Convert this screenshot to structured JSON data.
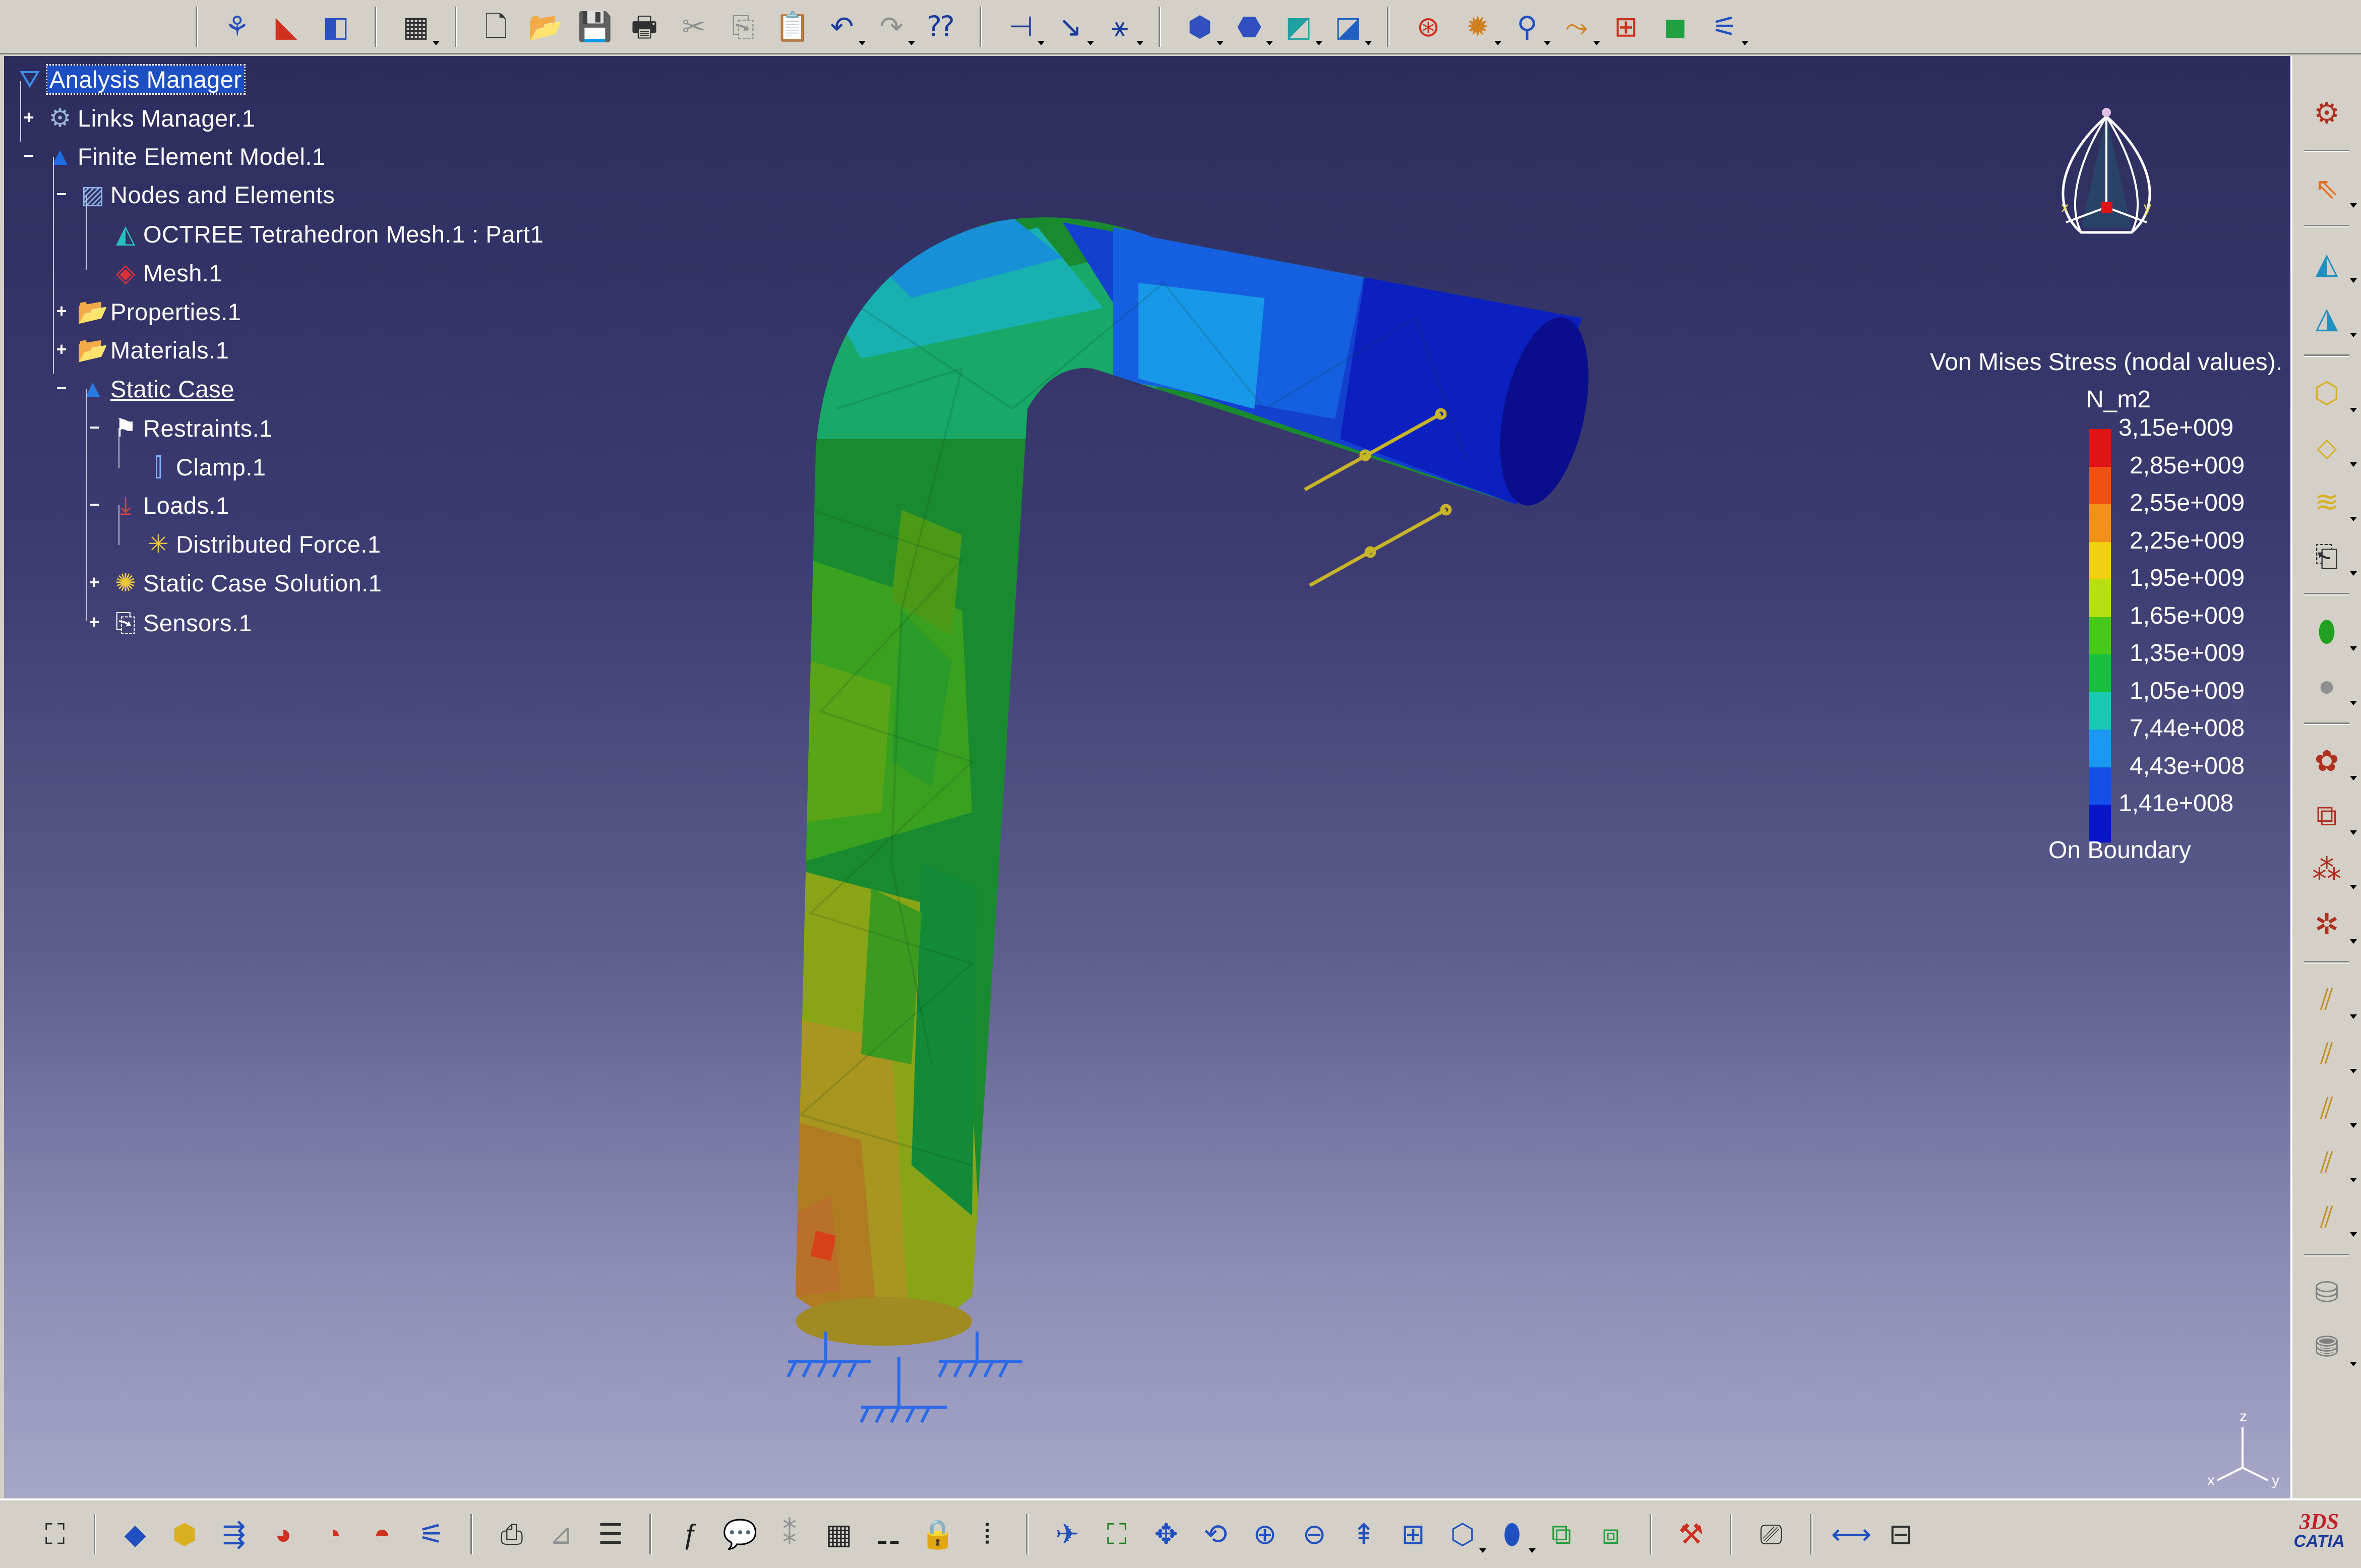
{
  "tree": {
    "nodes": [
      {
        "label": "Analysis Manager",
        "icon": "analysis-manager-icon",
        "glyph": "⛛",
        "color": "#3b8ee8"
      },
      {
        "label": "Links Manager.1",
        "icon": "links-manager-icon",
        "glyph": "⚙",
        "color": "#9ab3d9"
      },
      {
        "label": "Finite Element Model.1",
        "icon": "finite-element-model-icon",
        "glyph": "▲",
        "color": "#1f6ce0"
      },
      {
        "label": "Nodes and Elements",
        "icon": "nodes-elements-icon",
        "glyph": "▨",
        "color": "#8fb4e8"
      },
      {
        "label": "OCTREE Tetrahedron Mesh.1 : Part1",
        "icon": "tetra-mesh-icon",
        "glyph": "◭",
        "color": "#27c0c0"
      },
      {
        "label": "Mesh.1",
        "icon": "mesh-icon",
        "glyph": "◈",
        "color": "#d8303a"
      },
      {
        "label": "Properties.1",
        "icon": "folder-icon",
        "glyph": "📂",
        "color": "#e8c440"
      },
      {
        "label": "Materials.1",
        "icon": "folder-icon",
        "glyph": "📂",
        "color": "#e8c440"
      },
      {
        "label": "Static Case",
        "icon": "static-case-icon",
        "glyph": "▲",
        "color": "#2a7ae2"
      },
      {
        "label": "Restraints.1",
        "icon": "restraints-icon",
        "glyph": "⚑",
        "color": "#ffffff"
      },
      {
        "label": "Clamp.1",
        "icon": "clamp-icon",
        "glyph": "⫿",
        "color": "#80b0ff"
      },
      {
        "label": "Loads.1",
        "icon": "loads-icon",
        "glyph": "⤓",
        "color": "#e04040"
      },
      {
        "label": "Distributed Force.1",
        "icon": "distributed-force-icon",
        "glyph": "✳",
        "color": "#e8c440"
      },
      {
        "label": "Static Case Solution.1",
        "icon": "solution-icon",
        "glyph": "✺",
        "color": "#e8c440"
      },
      {
        "label": "Sensors.1",
        "icon": "sensors-icon",
        "glyph": "⎘",
        "color": "#ffffff"
      }
    ]
  },
  "legend": {
    "title": "Von Mises Stress (nodal values).",
    "unit": "N_m2",
    "values": [
      "3,15e+009",
      "2,85e+009",
      "2,55e+009",
      "2,25e+009",
      "1,95e+009",
      "1,65e+009",
      "1,35e+009",
      "1,05e+009",
      "7,44e+008",
      "4,43e+008",
      "1,41e+008"
    ],
    "colors": [
      "#e01414",
      "#f25010",
      "#f29018",
      "#f0d010",
      "#b8e010",
      "#48c818",
      "#18c040",
      "#18c8b0",
      "#1898f0",
      "#1450e8",
      "#0a14c8"
    ],
    "footer": "On Boundary"
  },
  "compass": {
    "x_label": "x",
    "y_label": "y"
  },
  "axis": {
    "x": "x",
    "y": "y",
    "z": "z"
  },
  "logo": {
    "mark": "3DS",
    "text": "CATIA"
  },
  "toolbars": {
    "top": [
      {
        "name": "sep"
      },
      {
        "name": "knowledge-icon",
        "glyph": "⚘",
        "color": "#2a4fbf"
      },
      {
        "name": "analysis-workbench-icon",
        "glyph": "◣",
        "color": "#d03020"
      },
      {
        "name": "sketch-analysis-icon",
        "glyph": "◧",
        "color": "#2a4fbf"
      },
      {
        "name": "sep"
      },
      {
        "name": "calculator-icon",
        "glyph": "▦",
        "color": "#303030",
        "drop": true
      },
      {
        "name": "sep"
      },
      {
        "name": "new-document-icon",
        "glyph": "🗋",
        "color": "#303030"
      },
      {
        "name": "open-folder-icon",
        "glyph": "📂",
        "color": "#d8a820"
      },
      {
        "name": "save-icon",
        "glyph": "💾",
        "color": "#303030"
      },
      {
        "name": "print-icon",
        "glyph": "🖶",
        "color": "#303030"
      },
      {
        "name": "cut-icon",
        "glyph": "✂",
        "color": "#909090"
      },
      {
        "name": "copy-icon",
        "glyph": "⎘",
        "color": "#909090"
      },
      {
        "name": "paste-icon",
        "glyph": "📋",
        "color": "#909090"
      },
      {
        "name": "undo-icon",
        "glyph": "↶",
        "color": "#1a3c9c",
        "drop": true
      },
      {
        "name": "redo-icon",
        "glyph": "↷",
        "color": "#909090",
        "drop": true
      },
      {
        "name": "whats-this-icon",
        "glyph": "⁇",
        "color": "#1a3c9c"
      },
      {
        "name": "sep"
      },
      {
        "name": "restraint-icon",
        "glyph": "⊣",
        "color": "#1a3c9c",
        "drop": true
      },
      {
        "name": "load-icon",
        "glyph": "↘",
        "color": "#1a3c9c",
        "drop": true
      },
      {
        "name": "mass-icon",
        "glyph": "⚹",
        "color": "#1a3c9c",
        "drop": true
      },
      {
        "name": "sep"
      },
      {
        "name": "compute-icon",
        "glyph": "⬢",
        "color": "#3050c0",
        "drop": true
      },
      {
        "name": "mesh-view-icon",
        "glyph": "⬣",
        "color": "#3050c0",
        "drop": true
      },
      {
        "name": "deformation-icon",
        "glyph": "◩",
        "color": "#20a0a0",
        "drop": true
      },
      {
        "name": "stress-icon",
        "glyph": "◪",
        "color": "#2060c0",
        "drop": true
      },
      {
        "name": "sep"
      },
      {
        "name": "image-edit-icon",
        "glyph": "⊛",
        "color": "#d03020"
      },
      {
        "name": "animate-icon",
        "glyph": "✹",
        "color": "#d08020",
        "drop": true
      },
      {
        "name": "light-icon",
        "glyph": "⚲",
        "color": "#2050c0",
        "drop": true
      },
      {
        "name": "cut-plane-icon",
        "glyph": "⤳",
        "color": "#d08020",
        "drop": true
      },
      {
        "name": "amplification-icon",
        "glyph": "⊞",
        "color": "#d03020"
      },
      {
        "name": "palette-icon",
        "glyph": "◼",
        "color": "#20a040"
      },
      {
        "name": "report-icon",
        "glyph": "⚟",
        "color": "#2050c0",
        "drop": true
      }
    ],
    "right": [
      {
        "name": "settings-icon",
        "glyph": "⚙",
        "color": "#b03020"
      },
      {
        "name": "sep"
      },
      {
        "name": "select-icon",
        "glyph": "⇖",
        "color": "#e07020",
        "drop": true
      },
      {
        "name": "sep"
      },
      {
        "name": "mesh-part-icon",
        "glyph": "◭",
        "color": "#2090c0",
        "drop": true
      },
      {
        "name": "mesh-spec-icon",
        "glyph": "◮",
        "color": "#2090c0",
        "drop": true
      },
      {
        "name": "sep"
      },
      {
        "name": "cube-icon",
        "glyph": "⬡",
        "color": "#d8b020",
        "drop": true
      },
      {
        "name": "plate-icon",
        "glyph": "⬦",
        "color": "#d8b020",
        "drop": true
      },
      {
        "name": "layers-icon",
        "glyph": "≋",
        "color": "#d8b020",
        "drop": true
      },
      {
        "name": "user-property-icon",
        "glyph": "⎗",
        "color": "#303030",
        "drop": true
      },
      {
        "name": "sep"
      },
      {
        "name": "material-icon",
        "glyph": "⬮",
        "color": "#20a020",
        "drop": true
      },
      {
        "name": "sphere-icon",
        "glyph": "●",
        "color": "#909090",
        "drop": true
      },
      {
        "name": "sep"
      },
      {
        "name": "group-icon",
        "glyph": "✿",
        "color": "#b03020",
        "drop": true
      },
      {
        "name": "group-box-icon",
        "glyph": "⧉",
        "color": "#b03020",
        "drop": true
      },
      {
        "name": "group-point-icon",
        "glyph": "⁂",
        "color": "#b03020",
        "drop": true
      },
      {
        "name": "group-sphere-icon",
        "glyph": "✲",
        "color": "#b03020",
        "drop": true
      },
      {
        "name": "sep"
      },
      {
        "name": "connection-icon",
        "glyph": "⫽",
        "color": "#c09020",
        "drop": true
      },
      {
        "name": "connection-2-icon",
        "glyph": "⫽",
        "color": "#c09020",
        "drop": true
      },
      {
        "name": "connection-3-icon",
        "glyph": "⫽",
        "color": "#c09020",
        "drop": true
      },
      {
        "name": "connection-4-icon",
        "glyph": "⫽",
        "color": "#c09020",
        "drop": true
      },
      {
        "name": "connection-5-icon",
        "glyph": "⫽",
        "color": "#c09020",
        "drop": true
      },
      {
        "name": "sep"
      },
      {
        "name": "bolt-icon",
        "glyph": "⛁",
        "color": "#808080"
      },
      {
        "name": "bolt-tightening-icon",
        "glyph": "⛃",
        "color": "#808080",
        "drop": true
      }
    ],
    "bottom": [
      {
        "name": "spec-tree-icon",
        "glyph": "⛶",
        "color": "#303030"
      },
      {
        "name": "sep"
      },
      {
        "name": "image-stress-icon",
        "glyph": "◆",
        "color": "#2050c0"
      },
      {
        "name": "image-deform-icon",
        "glyph": "⬢",
        "color": "#d8b020"
      },
      {
        "name": "image-displacement-icon",
        "glyph": "⇶",
        "color": "#2050c0"
      },
      {
        "name": "image-principal-icon",
        "glyph": "◕",
        "color": "#d03020"
      },
      {
        "name": "image-error-icon",
        "glyph": "◔",
        "color": "#d03020"
      },
      {
        "name": "image-animate-icon",
        "glyph": "◓",
        "color": "#d03020"
      },
      {
        "name": "image-report-icon",
        "glyph": "⚟",
        "color": "#2050c0"
      },
      {
        "name": "sep"
      },
      {
        "name": "sketch-icon",
        "glyph": "⎙",
        "color": "#303030"
      },
      {
        "name": "measure-icon",
        "glyph": "⊿",
        "color": "#909090"
      },
      {
        "name": "notes-icon",
        "glyph": "☰",
        "color": "#303030"
      },
      {
        "name": "sep"
      },
      {
        "name": "formula-icon",
        "glyph": "ƒ",
        "color": "#202020"
      },
      {
        "name": "comment-icon",
        "glyph": "💬",
        "color": "#202020"
      },
      {
        "name": "rule-icon",
        "glyph": "⁑",
        "color": "#909090"
      },
      {
        "name": "table-icon",
        "glyph": "▦",
        "color": "#202020"
      },
      {
        "name": "knowledge-tree-icon",
        "glyph": "⚋",
        "color": "#202020"
      },
      {
        "name": "lock-icon",
        "glyph": "🔒",
        "color": "#202020"
      },
      {
        "name": "parameters-icon",
        "glyph": "⦙",
        "color": "#202020"
      },
      {
        "name": "sep"
      },
      {
        "name": "fly-icon",
        "glyph": "✈",
        "color": "#2050c0"
      },
      {
        "name": "fit-all-icon",
        "glyph": "⛶",
        "color": "#208020"
      },
      {
        "name": "pan-icon",
        "glyph": "✥",
        "color": "#2050c0"
      },
      {
        "name": "rotate-icon",
        "glyph": "⟲",
        "color": "#2050c0"
      },
      {
        "name": "zoom-in-icon",
        "glyph": "⊕",
        "color": "#2050c0"
      },
      {
        "name": "zoom-out-icon",
        "glyph": "⊖",
        "color": "#2050c0"
      },
      {
        "name": "normal-view-icon",
        "glyph": "⇞",
        "color": "#2050c0"
      },
      {
        "name": "multi-view-icon",
        "glyph": "⊞",
        "color": "#2050c0"
      },
      {
        "name": "iso-view-icon",
        "glyph": "⬡",
        "color": "#2050c0",
        "drop": true
      },
      {
        "name": "shading-icon",
        "glyph": "⬮",
        "color": "#2050c0",
        "drop": true
      },
      {
        "name": "hide-show-icon",
        "glyph": "⧉",
        "color": "#20a040"
      },
      {
        "name": "swap-visible-icon",
        "glyph": "⧈",
        "color": "#20a040"
      },
      {
        "name": "sep"
      },
      {
        "name": "cut-view-icon",
        "glyph": "⚒",
        "color": "#d03020"
      },
      {
        "name": "sep"
      },
      {
        "name": "capture-icon",
        "glyph": "⎚",
        "color": "#303030"
      },
      {
        "name": "sep"
      },
      {
        "name": "measure-between-icon",
        "glyph": "⟷",
        "color": "#2050c0"
      },
      {
        "name": "measure-item-icon",
        "glyph": "⊟",
        "color": "#303030"
      }
    ]
  }
}
